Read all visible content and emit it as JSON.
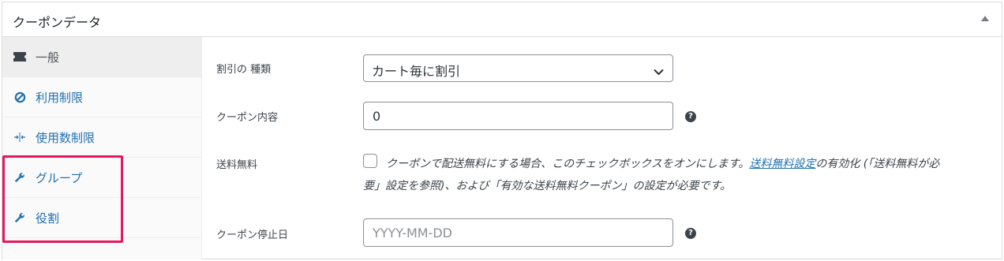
{
  "panel": {
    "title": "クーポンデータ"
  },
  "sidebar": {
    "items": [
      {
        "label": "一般",
        "icon": "ticket-icon"
      },
      {
        "label": "利用制限",
        "icon": "ban-icon"
      },
      {
        "label": "使用数制限",
        "icon": "arrows-collapse-icon"
      },
      {
        "label": "グループ",
        "icon": "wrench-icon"
      },
      {
        "label": "役割",
        "icon": "wrench-icon"
      }
    ]
  },
  "form": {
    "discount_type": {
      "label": "割引の 種類",
      "value": "カート毎に割引"
    },
    "coupon_amount": {
      "label": "クーポン内容",
      "value": "0"
    },
    "free_shipping": {
      "label": "送料無料",
      "desc_before": "クーポンで配送無料にする場合、このチェックボックスをオンにします。",
      "desc_link": "送料無料設定",
      "desc_after": "の有効化 (「送料無料が必",
      "desc_line2": "要」設定を参照)、および「有効な送料無料クーポン」の設定が必要です。"
    },
    "expiry_date": {
      "label": "クーポン停止日",
      "placeholder": "YYYY-MM-DD"
    },
    "help_glyph": "?"
  },
  "colors": {
    "link": "#2271b1",
    "highlight": "#e8175d"
  }
}
